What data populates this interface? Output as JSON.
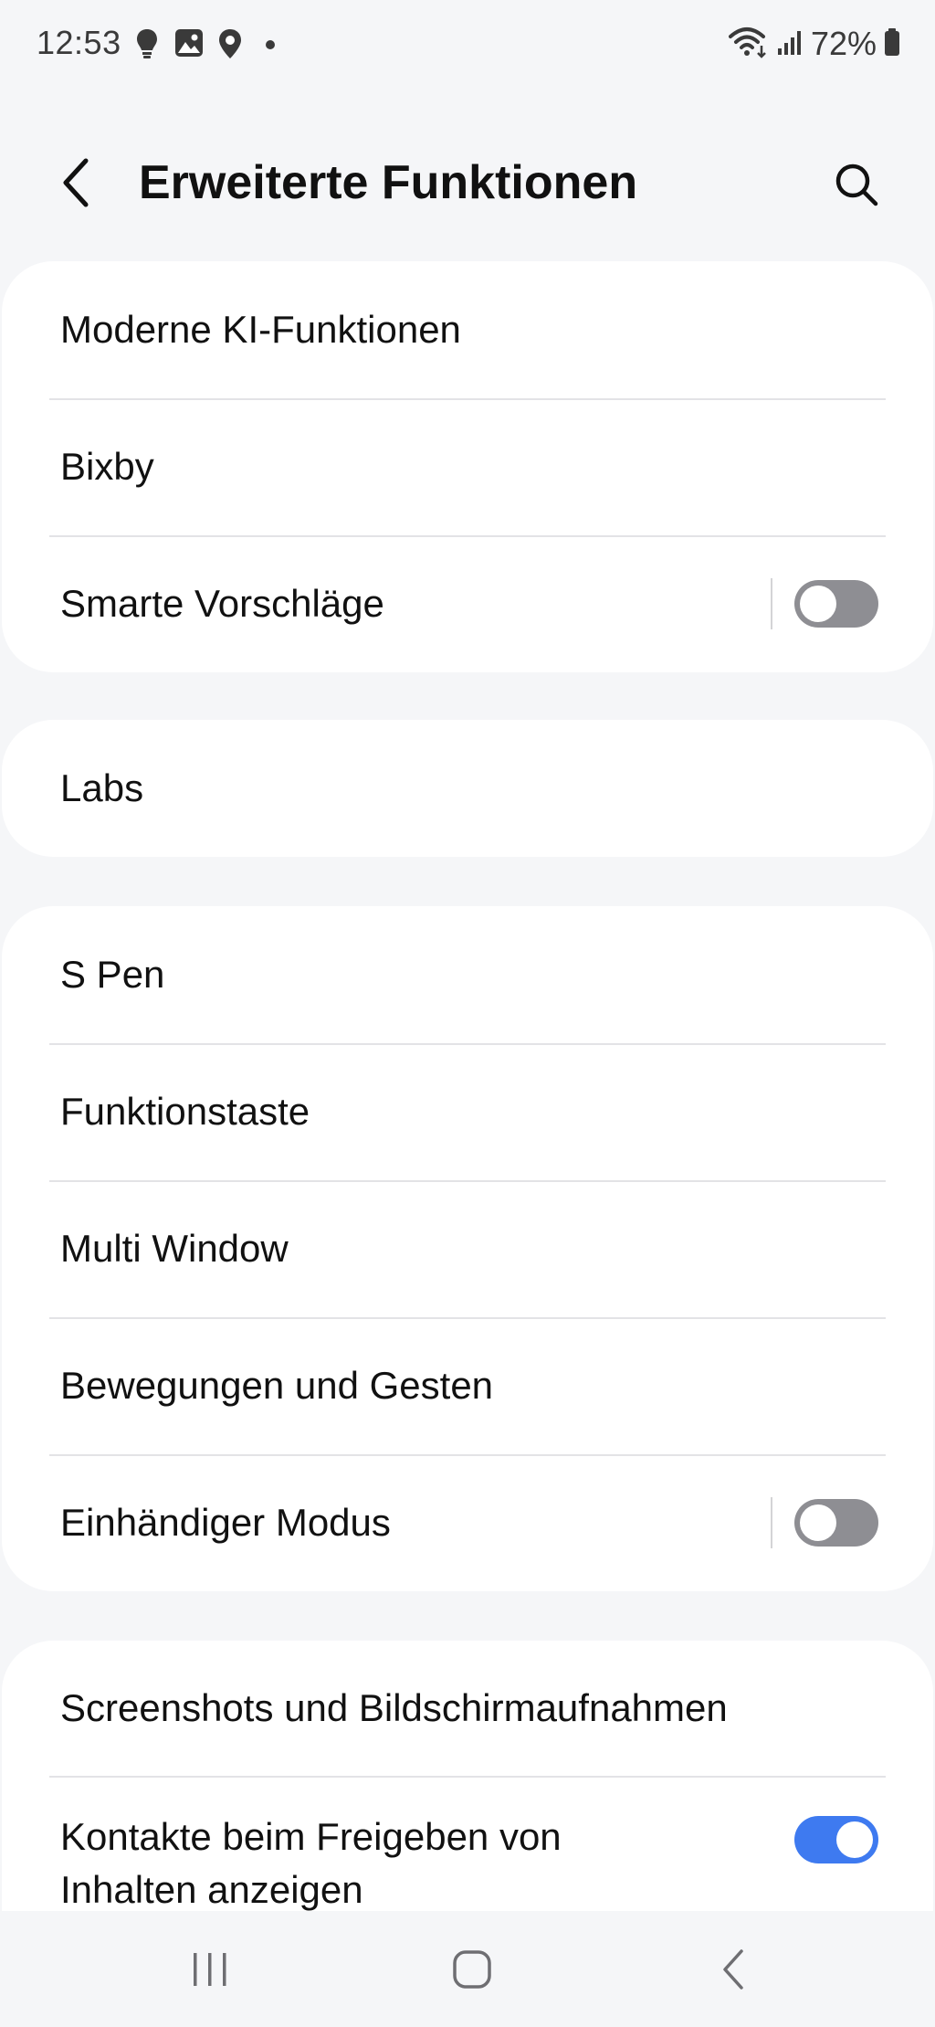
{
  "status_bar": {
    "time": "12:53",
    "battery": "72%",
    "icons": [
      "bulb-icon",
      "gallery-icon",
      "location-icon",
      "dot-icon",
      "wifi-icon",
      "signal-icon",
      "battery-icon"
    ]
  },
  "header": {
    "title": "Erweiterte Funktionen",
    "back_icon": "chevron-left-icon",
    "search_icon": "search-icon"
  },
  "groups": [
    {
      "items": [
        {
          "label": "Moderne KI-Funktionen"
        },
        {
          "label": "Bixby"
        },
        {
          "label": "Smarte Vorschläge",
          "toggle": "off"
        }
      ]
    },
    {
      "items": [
        {
          "label": "Labs"
        }
      ]
    },
    {
      "items": [
        {
          "label": "S Pen"
        },
        {
          "label": "Funktionstaste"
        },
        {
          "label": "Multi Window"
        },
        {
          "label": "Bewegungen und Gesten"
        },
        {
          "label": "Einhändiger Modus",
          "toggle": "off"
        }
      ]
    },
    {
      "items": [
        {
          "label": "Screenshots und Bildschirmaufnahmen"
        },
        {
          "label": "Kontakte beim Freigeben von Inhalten anzeigen",
          "toggle": "on"
        }
      ]
    }
  ],
  "nav_bar": {
    "buttons": [
      "recents-icon",
      "home-icon",
      "back-icon"
    ]
  },
  "colors": {
    "background": "#f5f6f8",
    "card": "#ffffff",
    "toggle_on": "#3e7af0",
    "toggle_off": "#8e8e93"
  }
}
